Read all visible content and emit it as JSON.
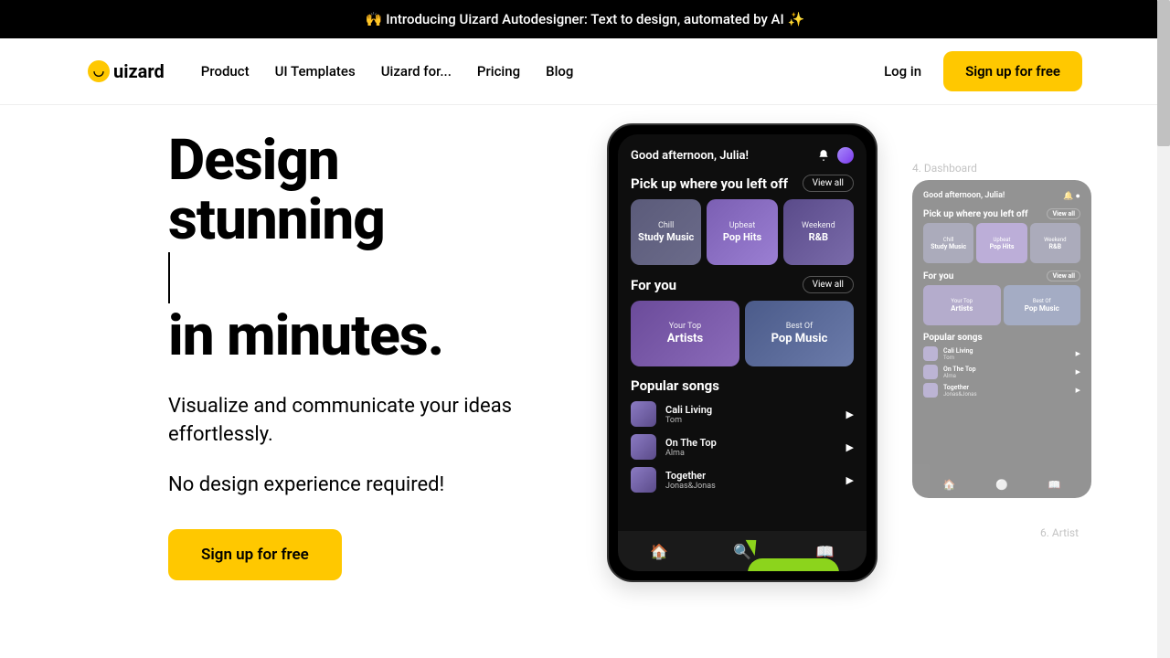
{
  "announcement": "🙌 Introducing Uizard Autodesigner: Text to design, automated by AI ✨",
  "logo": "uizard",
  "nav": {
    "items": [
      "Product",
      "UI Templates",
      "Uizard for...",
      "Pricing",
      "Blog"
    ],
    "login": "Log in",
    "signup": "Sign up for free"
  },
  "hero": {
    "line1": "Design",
    "line2": "stunning",
    "line3": "in minutes.",
    "sub1": "Visualize and communicate your ideas effortlessly.",
    "sub2": "No design experience required!",
    "cta": "Sign up for free"
  },
  "phone": {
    "greeting": "Good afternoon, Julia!",
    "section1": {
      "title": "Pick up where you left off",
      "view": "View all"
    },
    "cards": [
      {
        "sub": "Chill",
        "title": "Study Music"
      },
      {
        "sub": "Upbeat",
        "title": "Pop Hits"
      },
      {
        "sub": "Weekend",
        "title": "R&B"
      }
    ],
    "section2": {
      "title": "For you",
      "view": "View all"
    },
    "cards2": [
      {
        "sub": "Your Top",
        "title": "Artists"
      },
      {
        "sub": "Best Of",
        "title": "Pop Music"
      }
    ],
    "section3": "Popular songs",
    "songs": [
      {
        "title": "Cali Living",
        "artist": "Tom"
      },
      {
        "title": "On The Top",
        "artist": "Alma"
      },
      {
        "title": "Together",
        "artist": "Jonas&Jonas"
      }
    ]
  },
  "sketch": {
    "label1": "4. Dashboard",
    "label2": "6. Artist"
  }
}
